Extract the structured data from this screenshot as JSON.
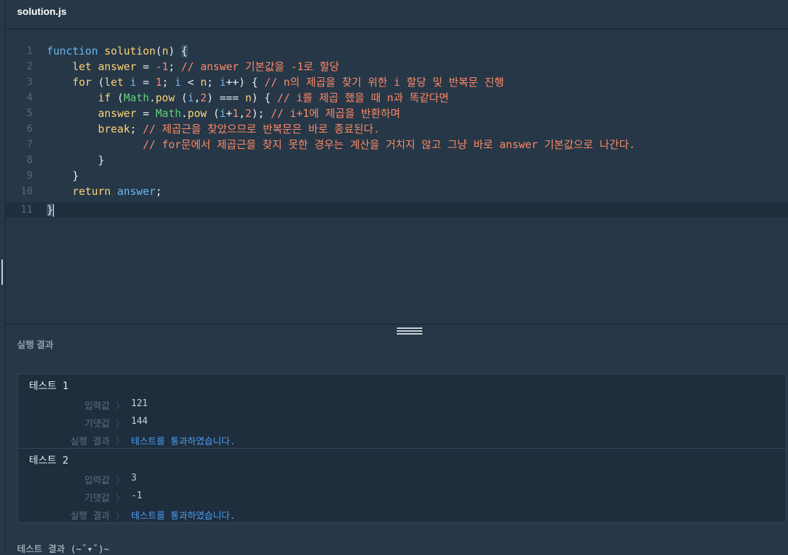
{
  "tab": {
    "filename": "solution.js"
  },
  "editor": {
    "line_numbers": [
      "1",
      "2",
      "3",
      "4",
      "5",
      "6",
      "7",
      "8",
      "9",
      "10",
      "11"
    ]
  },
  "results_panel": {
    "title": "실행 결과"
  },
  "tests": [
    {
      "name": "테스트 1",
      "input_label": "입력값",
      "input_value": "121",
      "expected_label": "기댓값",
      "expected_value": "144",
      "result_label": "실행 결과",
      "result_value": "테스트를 통과하였습니다."
    },
    {
      "name": "테스트 2",
      "input_label": "입력값",
      "input_value": "3",
      "expected_label": "기댓값",
      "expected_value": "-1",
      "result_label": "실행 결과",
      "result_value": "테스트를 통과하였습니다."
    }
  ],
  "separator_glyph": "〉",
  "footer": {
    "text": "테스트 결과 (~ˇ▾ˇ)~"
  },
  "colors": {
    "background": "#263747",
    "pass": "#4e9cf5",
    "comment": "#ff8a65",
    "keyword": "#ffd479",
    "object": "#5fd17a"
  }
}
